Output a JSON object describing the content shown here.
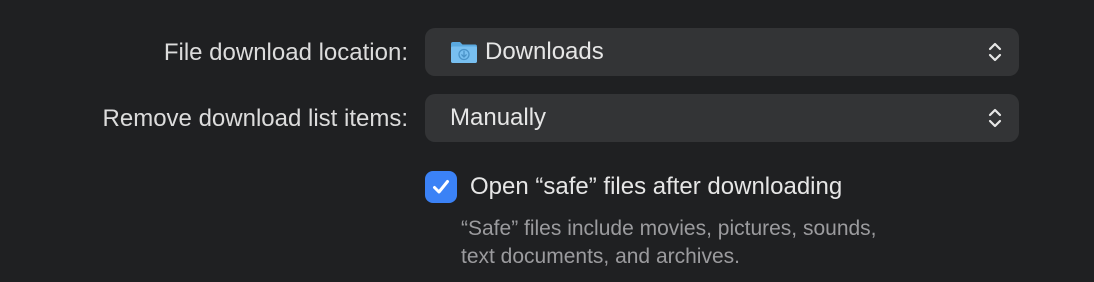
{
  "download_location": {
    "label": "File download location:",
    "value": "Downloads",
    "icon": "folder-downloads-icon"
  },
  "remove_items": {
    "label": "Remove download list items:",
    "value": "Manually"
  },
  "open_safe": {
    "label": "Open “safe” files after downloading",
    "checked": true,
    "help_line1": "“Safe” files include movies, pictures, sounds,",
    "help_line2": "text documents, and archives."
  },
  "colors": {
    "background": "#1f2022",
    "popup": "#333436",
    "accent": "#3b82f6",
    "folder": "#6ab4e8"
  }
}
